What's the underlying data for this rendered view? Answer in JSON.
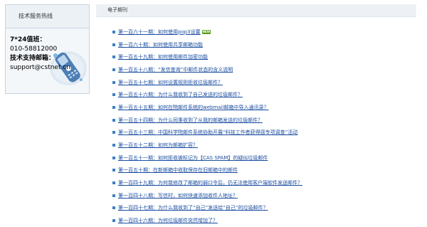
{
  "support": {
    "title": "技术服务热线",
    "hours_label": "7*24值班：",
    "phone": "010-58812000",
    "email_label": "技术支持邮箱：",
    "email": "support@cstnet.cn",
    "decoration_icon": "phone-icon"
  },
  "header": {
    "title": "电子期刊"
  },
  "issues": [
    {
      "label": "第一百六十一期：如何使用pop3设置",
      "badge": "NEW"
    },
    {
      "label": "第一百六十期：如何使用共享邮箱功能"
    },
    {
      "label": "第一百五十九期：如何使用邮件加密功能"
    },
    {
      "label": "第一百五十八期：“发信查询”中邮件状态的含义说明"
    },
    {
      "label": "第一百五十七期：如何设置规则拒收垃圾邮件？"
    },
    {
      "label": "第一百五十六期：为什么我收到了自己发送的垃圾邮件？"
    },
    {
      "label": "第一百五十五期：如何在院邮件系统的webmail邮箱中导入通讯录？"
    },
    {
      "label": "第一百五十四期：为什么同事收到了从我的邮箱发送的垃圾邮件？"
    },
    {
      "label": "第一百五十三期：中国科学院邮件系统协助开展“科技工作者获得感专项调查”活动"
    },
    {
      "label": "第一百五十二期：如何为邮箱扩容？"
    },
    {
      "label": "第一百五十一期：如何拒收被标记为【CAS SPAM】的疑似垃圾邮件"
    },
    {
      "label": "第一百五十期：在新邮箱中收取保存在旧邮箱中的邮件"
    },
    {
      "label": "第一百四十九期：为何我修改了邮箱的弱口令后，仍无法使用客户端软件发送邮件？"
    },
    {
      "label": "第一百四十八期：写信时，如何快速添加收件人地址？"
    },
    {
      "label": "第一百四十七期：为什么我收到了“自己”发送给“自己”的垃圾邮件？"
    },
    {
      "label": "第一百四十六期：为何垃圾邮件突然增加了？"
    }
  ],
  "colors": {
    "link": "#1b4ea0",
    "bullet": "#3a7ec4",
    "header_bg": "#edf1f5",
    "badge_bg": "#5a9b1c"
  }
}
